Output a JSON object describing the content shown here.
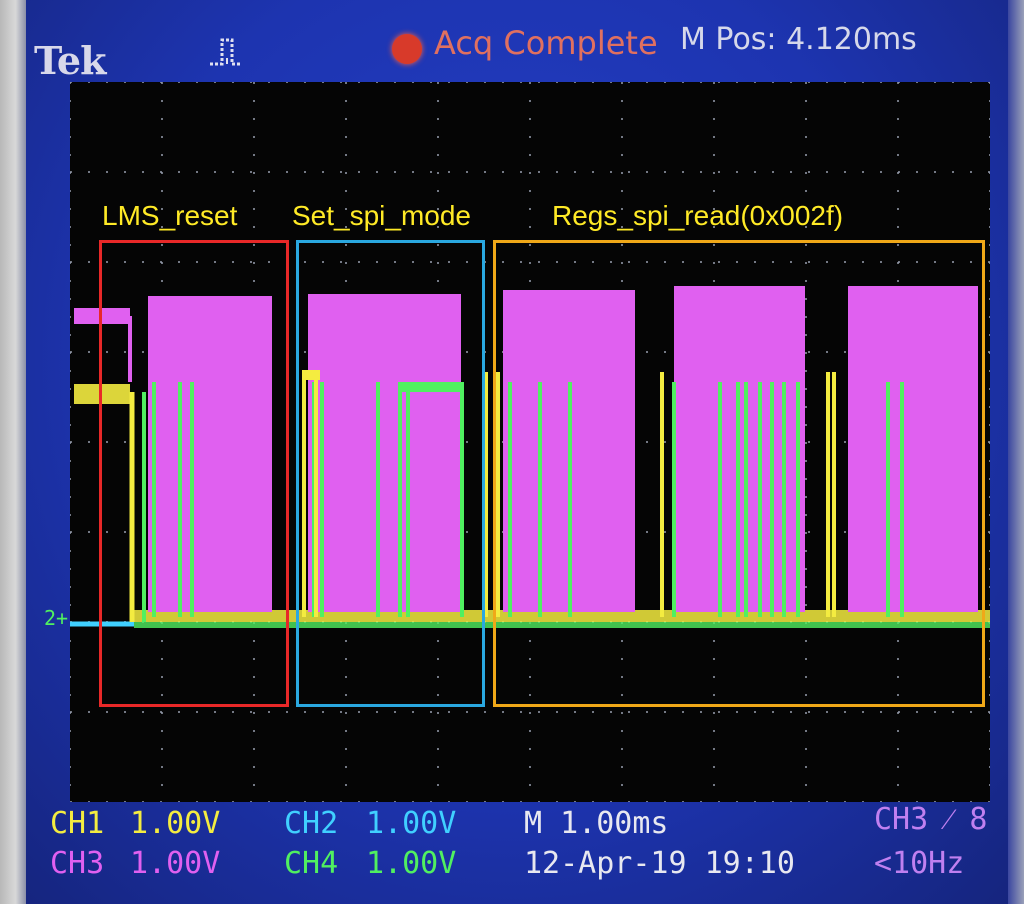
{
  "header": {
    "brand": "Tek",
    "status": "Acq Complete",
    "position": "M Pos: 4.120ms"
  },
  "annotations": [
    {
      "label": "LMS_reset",
      "color": "#e82828"
    },
    {
      "label": "Set_spi_mode",
      "color": "#2aa8e0"
    },
    {
      "label": "Regs_spi_read(0x002f)",
      "color": "#f0a818"
    }
  ],
  "channels": {
    "ch1": {
      "name": "CH1",
      "scale": "1.00V",
      "color": "#f4ec40"
    },
    "ch2": {
      "name": "CH2",
      "scale": "1.00V",
      "color": "#40d0ff"
    },
    "ch3": {
      "name": "CH3",
      "scale": "1.00V",
      "color": "#e060f0"
    },
    "ch4": {
      "name": "CH4",
      "scale": "1.00V",
      "color": "#50f060"
    }
  },
  "timebase": "M 1.00ms",
  "datetime": "12-Apr-19 19:10",
  "trigger": {
    "source": "CH3 ⁄ 8",
    "frequency": "<10Hz"
  },
  "ground_marker": "2+",
  "icons": {
    "trigger": "trigger-pulse-icon",
    "acquire": "acq-run-dot-icon",
    "trigger_pos": "trigger-position-arrow-icon"
  }
}
